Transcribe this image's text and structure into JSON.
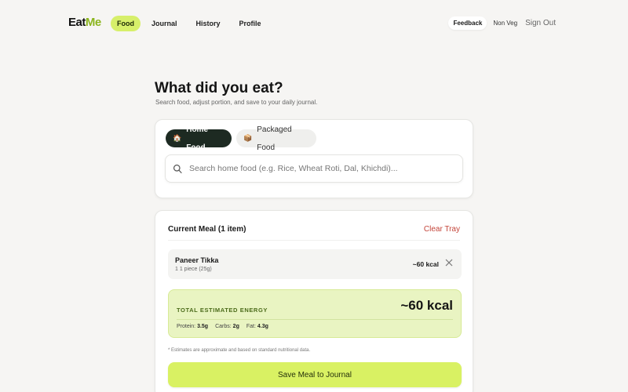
{
  "brand": {
    "part1": "Eat",
    "part2": "Me"
  },
  "nav": {
    "links": [
      {
        "label": "Food",
        "active": true
      },
      {
        "label": "Journal"
      },
      {
        "label": "History"
      },
      {
        "label": "Profile"
      }
    ],
    "feedback_label": "Feedback",
    "diet_label": "Non Veg",
    "signout_label": "Sign Out"
  },
  "header": {
    "title": "What did you eat?",
    "subtitle": "Search food, adjust portion, and save to your daily journal."
  },
  "search": {
    "tabs": [
      {
        "label": "Home Food",
        "icon": "house-icon",
        "glyph": "🏠",
        "active": true
      },
      {
        "label": "Packaged Food",
        "icon": "box-icon",
        "glyph": "📦",
        "active": false
      }
    ],
    "placeholder": "Search home food (e.g. Rice, Wheat Roti, Dal, Khichdi)...",
    "value": ""
  },
  "meal": {
    "title": "Current Meal (1 item)",
    "clear_label": "Clear Tray",
    "items": [
      {
        "name": "Paneer Tikka",
        "portion": "1 1 piece (25g)",
        "kcal": "~60 kcal"
      }
    ],
    "energy": {
      "label": "TOTAL ESTIMATED ENERGY",
      "value": "~60 kcal",
      "protein_label": "Protein:",
      "protein": "3.5g",
      "carbs_label": "Carbs:",
      "carbs": "2g",
      "fat_label": "Fat:",
      "fat": "4.3g"
    },
    "note": "* Estimates are approximate and based on standard nutritional data.",
    "save_label": "Save Meal to Journal"
  },
  "colors": {
    "accent": "#d9f163",
    "brand_green": "#8bb51d",
    "danger": "#c4453a",
    "dark_tab": "#1d2a22"
  }
}
